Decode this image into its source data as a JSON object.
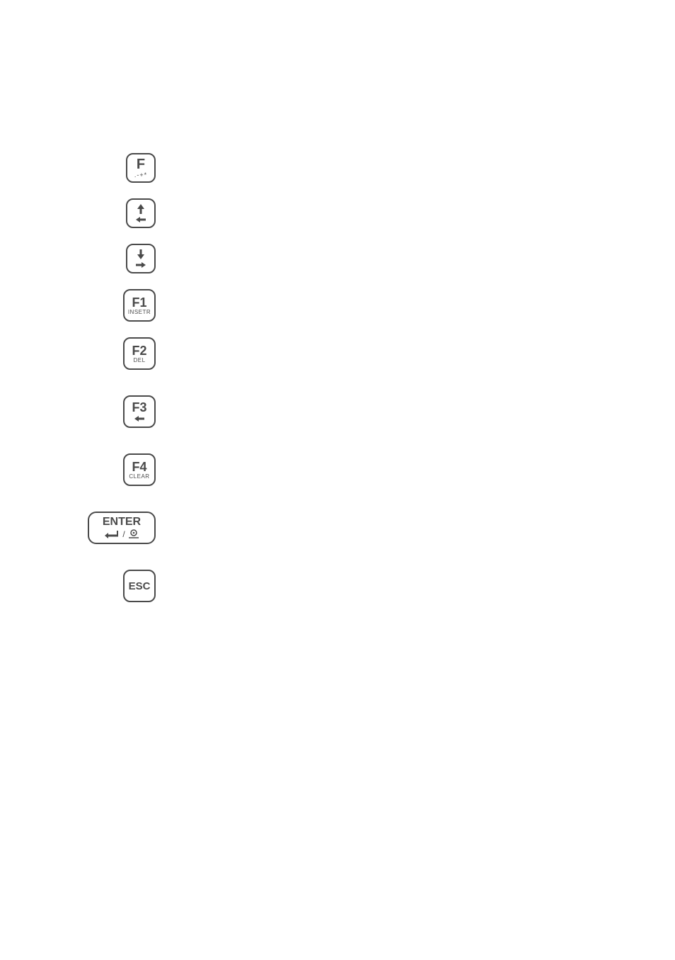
{
  "keys": {
    "f": {
      "main": "F",
      "sub": ".-+*"
    },
    "f1": {
      "main": "F1",
      "sub": "INSETR"
    },
    "f2": {
      "main": "F2",
      "sub": "DEL"
    },
    "f3": {
      "main": "F3"
    },
    "f4": {
      "main": "F4",
      "sub": "CLEAR"
    },
    "enter": {
      "main": "ENTER",
      "sep": "/"
    },
    "esc": {
      "main": "ESC"
    }
  }
}
